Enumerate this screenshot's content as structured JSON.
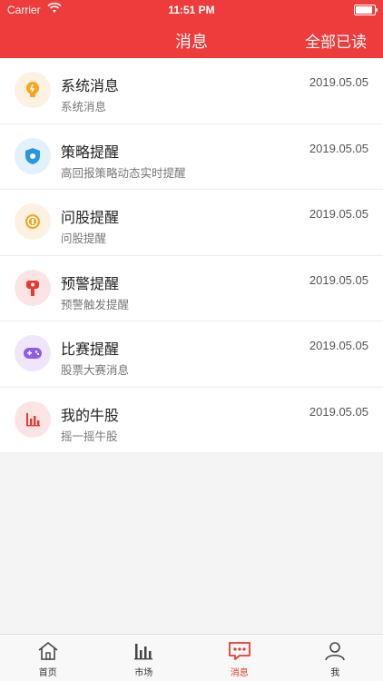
{
  "status_bar": {
    "carrier": "Carrier",
    "time": "11:51 PM"
  },
  "nav": {
    "title": "消息",
    "right_action": "全部已读"
  },
  "colors": {
    "primary": "#ee3b3b"
  },
  "messages": [
    {
      "title": "系统消息",
      "subtitle": "系统消息",
      "date": "2019.05.05",
      "icon": "lightbulb-icon"
    },
    {
      "title": "策略提醒",
      "subtitle": "高回报策略动态实时提醒",
      "date": "2019.05.05",
      "icon": "shield-icon"
    },
    {
      "title": "问股提醒",
      "subtitle": "问股提醒",
      "date": "2019.05.05",
      "icon": "coin-icon"
    },
    {
      "title": "预警提醒",
      "subtitle": "预警触发提醒",
      "date": "2019.05.05",
      "icon": "traffic-light-icon"
    },
    {
      "title": "比赛提醒",
      "subtitle": "股票大赛消息",
      "date": "2019.05.05",
      "icon": "gamepad-icon"
    },
    {
      "title": "我的牛股",
      "subtitle": "摇一摇牛股",
      "date": "2019.05.05",
      "icon": "bar-chart-icon"
    }
  ],
  "tabbar": [
    {
      "label": "首页",
      "icon": "home-icon"
    },
    {
      "label": "市场",
      "icon": "market-chart-icon"
    },
    {
      "label": "消息",
      "icon": "message-icon",
      "active": true
    },
    {
      "label": "我",
      "icon": "profile-icon"
    }
  ]
}
